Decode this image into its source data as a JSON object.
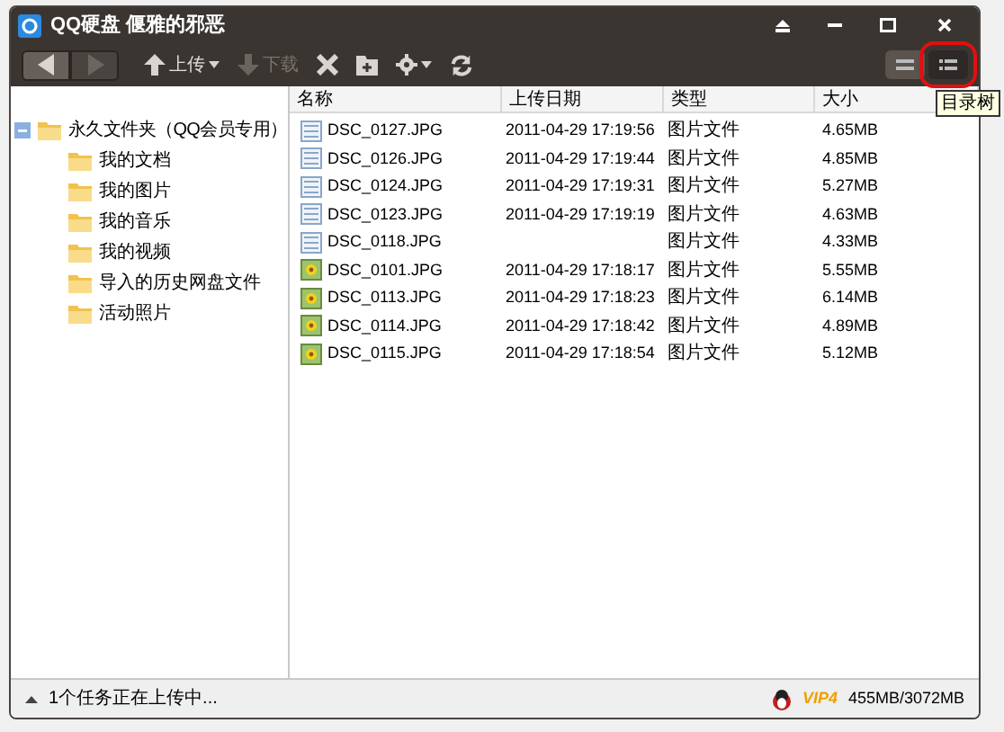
{
  "window": {
    "title": "QQ硬盘 偃雅的邪恶"
  },
  "toolbar": {
    "items": [
      {
        "kind": "back",
        "disabled": false
      },
      {
        "kind": "forward",
        "disabled": true
      },
      {
        "kind": "upload",
        "label": "上传",
        "disabled": false
      },
      {
        "kind": "download",
        "label": "下载",
        "disabled": true
      },
      {
        "kind": "delete",
        "disabled": false
      },
      {
        "kind": "new-folder",
        "disabled": false
      },
      {
        "kind": "settings",
        "disabled": false
      },
      {
        "kind": "refresh",
        "disabled": false
      }
    ],
    "views": [
      {
        "kind": "list",
        "selected": false
      },
      {
        "kind": "tree",
        "selected": true
      }
    ],
    "tooltip": "目录树"
  },
  "tree": {
    "label": "永久文件夹（QQ会员专用）",
    "expanded": true,
    "children": [
      {
        "label": "我的文档"
      },
      {
        "label": "我的图片"
      },
      {
        "label": "我的音乐"
      },
      {
        "label": "我的视频"
      },
      {
        "label": "导入的历史网盘文件"
      },
      {
        "label": "活动照片"
      }
    ]
  },
  "table": {
    "columns": [
      "名称",
      "上传日期",
      "类型",
      "大小"
    ],
    "rows": [
      {
        "kind": "file",
        "name": "DSC_0127.JPG",
        "date": "2011-04-29 17:19:56",
        "type": "图片文件",
        "size": "4.65MB"
      },
      {
        "kind": "file",
        "name": "DSC_0126.JPG",
        "date": "2011-04-29 17:19:44",
        "type": "图片文件",
        "size": "4.85MB"
      },
      {
        "kind": "file",
        "name": "DSC_0124.JPG",
        "date": "2011-04-29 17:19:31",
        "type": "图片文件",
        "size": "5.27MB"
      },
      {
        "kind": "file",
        "name": "DSC_0123.JPG",
        "date": "2011-04-29 17:19:19",
        "type": "图片文件",
        "size": "4.63MB"
      },
      {
        "kind": "file",
        "name": "DSC_0118.JPG",
        "type": "图片文件",
        "size": "4.33MB"
      },
      {
        "kind": "photo",
        "name": "DSC_0101.JPG",
        "date": "2011-04-29 17:18:17",
        "type": "图片文件",
        "size": "5.55MB"
      },
      {
        "kind": "photo",
        "name": "DSC_0113.JPG",
        "date": "2011-04-29 17:18:23",
        "type": "图片文件",
        "size": "6.14MB"
      },
      {
        "kind": "photo",
        "name": "DSC_0114.JPG",
        "date": "2011-04-29 17:18:42",
        "type": "图片文件",
        "size": "4.89MB"
      },
      {
        "kind": "photo",
        "name": "DSC_0115.JPG",
        "date": "2011-04-29 17:18:54",
        "type": "图片文件",
        "size": "5.12MB"
      }
    ]
  },
  "status_bar": {
    "task": "1个任务正在上传中...",
    "vip": "VIP4",
    "quota": "455MB/3072MB"
  }
}
